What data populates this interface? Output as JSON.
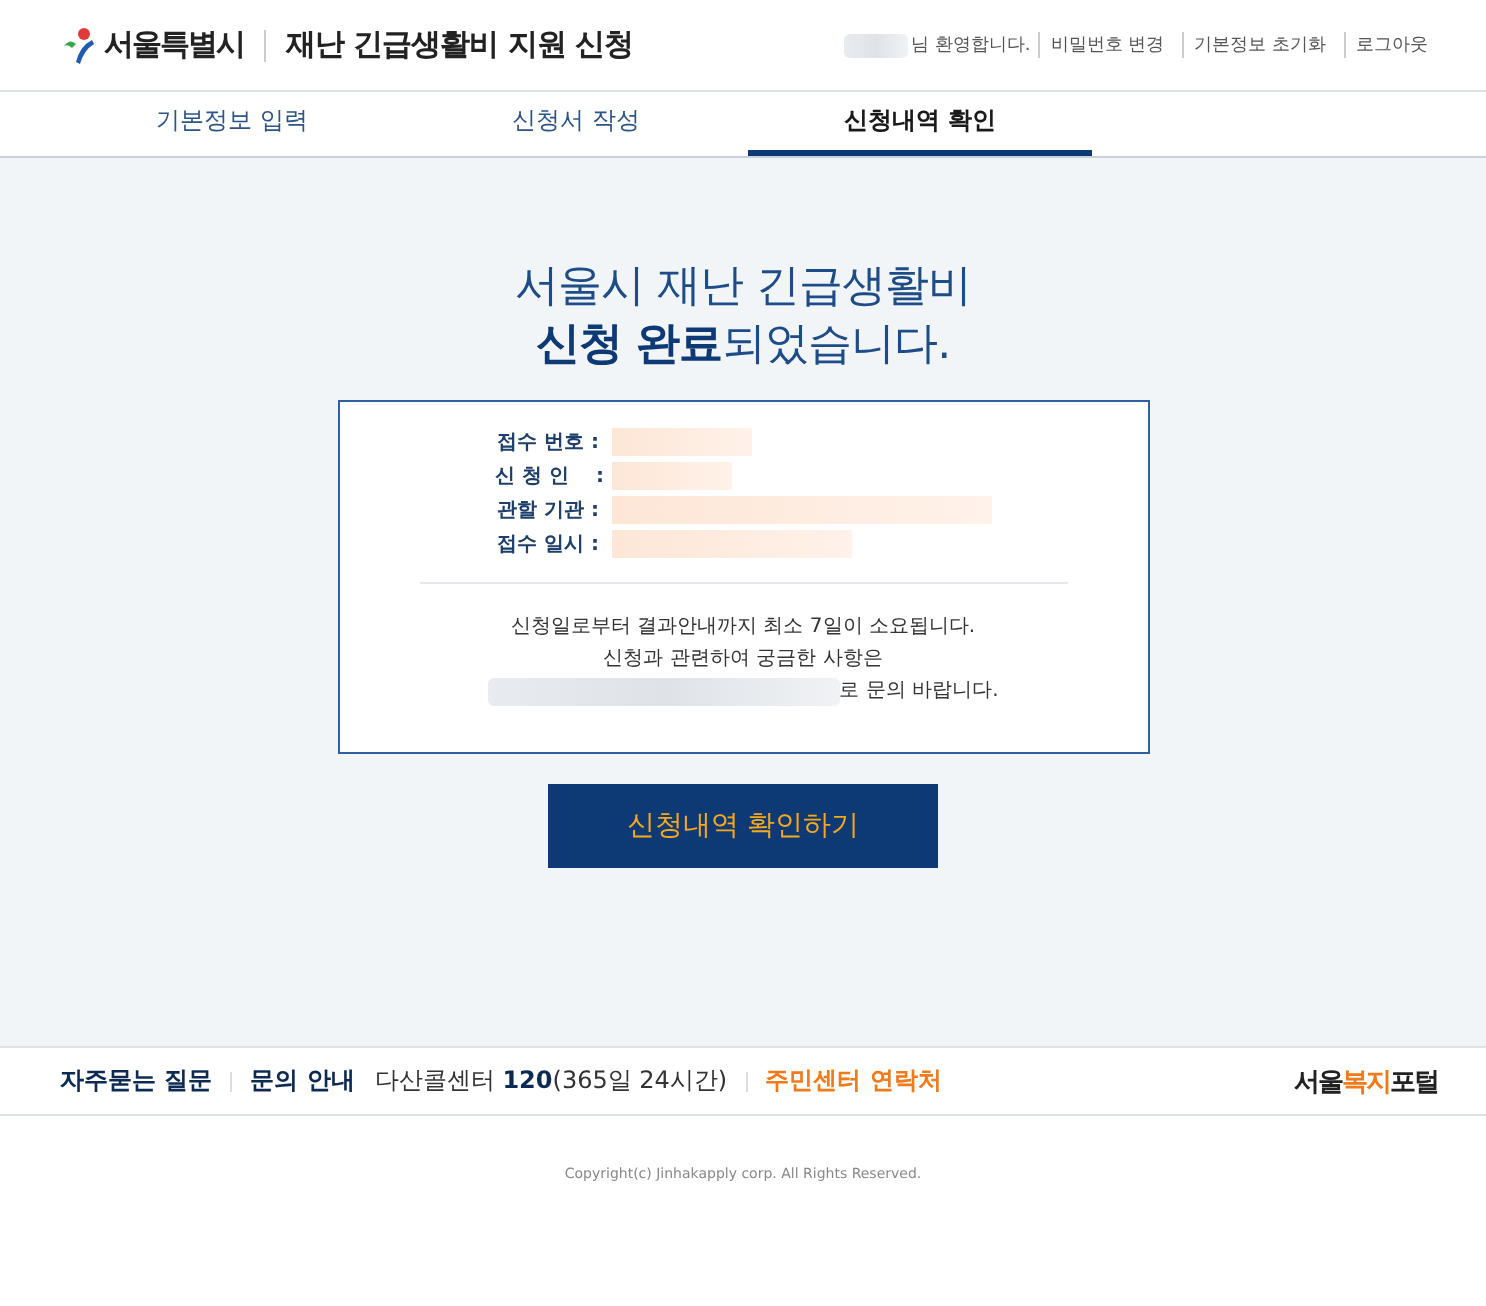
{
  "header": {
    "logo_text": "서울특별시",
    "title": "재난 긴급생활비 지원 신청",
    "welcome": "님 환영합니다.",
    "links": [
      "비밀번호 변경",
      "기본정보 초기화",
      "로그아웃"
    ]
  },
  "tabs": [
    {
      "label": "기본정보 입력",
      "selected": false
    },
    {
      "label": "신청서 작성",
      "selected": false
    },
    {
      "label": "신청내역 확인",
      "selected": true
    }
  ],
  "heading": {
    "line1": "서울시 재난 긴급생활비",
    "line2": "**신청 완료**되었습니다."
  },
  "receipt": {
    "fields": [
      {
        "label": "접수 번호 :"
      },
      {
        "label": "신 청 인 　:"
      },
      {
        "label": "관할 기관 :"
      },
      {
        "label": "접수 일시 :"
      }
    ],
    "notes": [
      "신청일로부터 결과안내까지 최소 7일이 소요됩니다.",
      "신청과 관련하여 궁금한 사항은",
      "로 문의 바랍니다."
    ]
  },
  "confirm_button": "신청내역 확인하기",
  "footer": {
    "items": [
      {
        "text": "**자주묻는 질문**",
        "kind": "link"
      },
      {
        "text": "**문의 안내**",
        "kind": "link"
      },
      {
        "text": "다산콜센터 **120**(365일 24시간)",
        "kind": "info"
      },
      {
        "text": "**주민센터 연락처**",
        "kind": "highlight"
      }
    ],
    "brand": [
      {
        "text": "서울",
        "kind": "plain"
      },
      {
        "text": "복지",
        "kind": "accent"
      },
      {
        "text": "포털",
        "kind": "plain"
      }
    ]
  },
  "copyright": "Copyright(c) Jinhakapply corp. All Rights Reserved."
}
